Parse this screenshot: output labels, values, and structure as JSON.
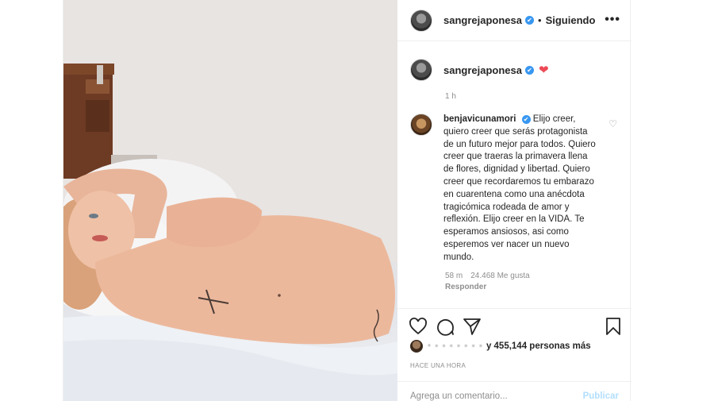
{
  "header": {
    "username": "sangrejaponesa",
    "verified_mark": "✔",
    "separator": "•",
    "follow_status": "Siguiendo",
    "more_icon": "more-dots-icon",
    "more_label": "•••"
  },
  "caption": {
    "username": "sangrejaponesa",
    "verified_mark": "✔",
    "emoji": "❤",
    "time": "1 h"
  },
  "comment": {
    "username": "benjavicunamori",
    "verified_mark": "✔",
    "text": "Elijo creer, quiero creer que serás protagonista de un futuro mejor para todos. Quiero creer que traeras la primavera llena de flores, dignidad y libertad. Quiero creer que recordaremos tu embarazo en cuarentena como una anécdota tragicómica rodeada de amor y reflexión. Elijo creer en la VIDA. Te esperamos ansiosos, asi como esperemos ver nacer un nuevo mundo.",
    "time": "58 m",
    "likes": "24.468 Me gusta",
    "reply_label": "Responder",
    "like_icon": "♡"
  },
  "actions": {
    "icons": [
      "heart-icon",
      "comment-icon",
      "share-icon",
      "bookmark-icon"
    ]
  },
  "likes": {
    "blurred_names": "• ▪ ▪ ▪ ▪ ▪ ▪ ▪",
    "text": "y 455,144 personas más"
  },
  "timestamp": "HACE UNA HORA",
  "add_comment": {
    "placeholder": "Agrega un comentario...",
    "publish_label": "Publicar"
  },
  "colors": {
    "verified": "#3897f0",
    "publish_disabled": "#b2dffc",
    "heart_emoji": "#ed4956"
  }
}
